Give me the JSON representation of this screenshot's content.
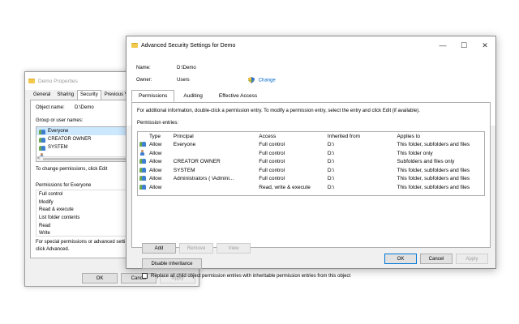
{
  "props": {
    "title": "Demo Properties",
    "tabs": [
      "General",
      "Sharing",
      "Security",
      "Previous V"
    ],
    "object_name_label": "Object name:",
    "object_name_value": "D:\\Demo",
    "group_label": "Group or user names:",
    "users": [
      "Everyone",
      "CREATOR OWNER",
      "SYSTEM",
      ""
    ],
    "scroll_arrow": "<",
    "change_text": "To change permissions, click Edit",
    "permissions_for": "Permissions for Everyone",
    "permissions": [
      "Full control",
      "Modify",
      "Read & execute",
      "List folder contents",
      "Read",
      "Write"
    ],
    "special_text_1": "For special permissions or advanced setti",
    "special_text_2": "click Advanced.",
    "ok": "OK",
    "cancel": "Cancel",
    "apply": "Apply"
  },
  "adv": {
    "title": "Advanced Security Settings for Demo",
    "minimize": "—",
    "maximize": "☐",
    "close": "✕",
    "name_label": "Name:",
    "name_value": "D:\\Demo",
    "owner_label": "Owner:",
    "owner_value": "Users",
    "change_link": "Change",
    "tabs": [
      "Permissions",
      "Auditing",
      "Effective Access"
    ],
    "info_text": "For additional information, double-click a permission entry. To modify a permission entry, select the entry and click Edit (if available).",
    "entries_label": "Permission entries:",
    "columns": [
      "Type",
      "Principal",
      "Access",
      "Inherited from",
      "Applies to"
    ],
    "rows": [
      {
        "type": "Allow",
        "principal": "Everyone",
        "access": "Full control",
        "inherited": "D:\\",
        "applies": "This folder, subfolders and files",
        "icon": "group"
      },
      {
        "type": "Allow",
        "principal": "",
        "access": "Full control",
        "inherited": "D:\\",
        "applies": "This folder only",
        "icon": "user"
      },
      {
        "type": "Allow",
        "principal": "CREATOR OWNER",
        "access": "Full control",
        "inherited": "D:\\",
        "applies": "Subfolders and files only",
        "icon": "group"
      },
      {
        "type": "Allow",
        "principal": "SYSTEM",
        "access": "Full control",
        "inherited": "D:\\",
        "applies": "This folder, subfolders and files",
        "icon": "group"
      },
      {
        "type": "Allow",
        "principal": "Administrators (            \\Admini...",
        "access": "Full control",
        "inherited": "D:\\",
        "applies": "This folder, subfolders and files",
        "icon": "group"
      },
      {
        "type": "Allow",
        "principal": "",
        "access": "Read, write & execute",
        "inherited": "D:\\",
        "applies": "This folder, subfolders and files",
        "icon": "group"
      }
    ],
    "add": "Add",
    "remove": "Remove",
    "view": "View",
    "disable_inheritance": "Disable inheritance",
    "replace_text": "Replace all child object permission entries with inheritable permission entries from this object",
    "ok": "OK",
    "cancel": "Cancel",
    "apply": "Apply"
  }
}
